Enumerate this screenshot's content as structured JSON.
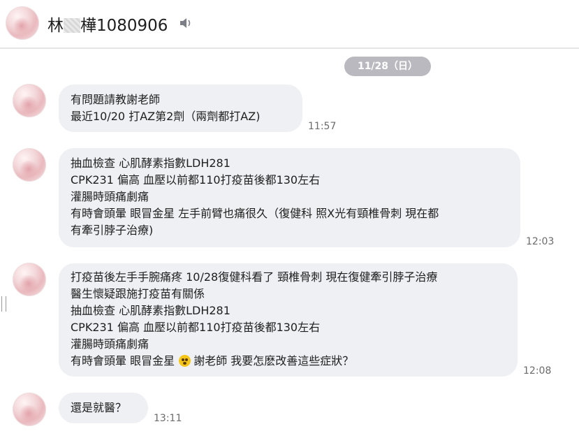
{
  "header": {
    "name_prefix": "林",
    "name_suffix": "樺1080906",
    "speaker_icon": "speaker-icon"
  },
  "date_chip": "11/28（日）",
  "messages": [
    {
      "lines": [
        "有問題請教謝老師",
        "最近10/20 打AZ第2劑（兩劑都打AZ)"
      ],
      "time": "11:57"
    },
    {
      "lines": [
        "抽血檢查 心肌酵素指數LDH281",
        "CPK231 偏高 血壓以前都110打疫苗後都130左右",
        "灌腸時頭痛劇痛",
        "有時會頭暈 眼冒金星 左手前臂也痛很久（復健科 照X光有頸椎骨刺 現在都",
        "有牽引脖子治療)"
      ],
      "time": "12:03"
    },
    {
      "lines": [
        " 打疫苗後左手手腕痛疼 10/28復健科看了 頸椎骨刺 現在復健牽引脖子治療",
        "醫生懷疑跟施打疫苗有關係",
        "抽血檢查 心肌酵素指數LDH281",
        "CPK231 偏高 血壓以前都110打疫苗後都130左右",
        "灌腸時頭痛劇痛"
      ],
      "last_line_before_emoji": "有時會頭暈 眼冒金星 ",
      "last_line_after_emoji": "謝老師 我要怎麽改善這些症狀？",
      "emoji_icon": "dizzy-face-emoji-icon",
      "time": "12:08"
    },
    {
      "lines": [
        "還是就醫？"
      ],
      "time": "13:11"
    }
  ]
}
